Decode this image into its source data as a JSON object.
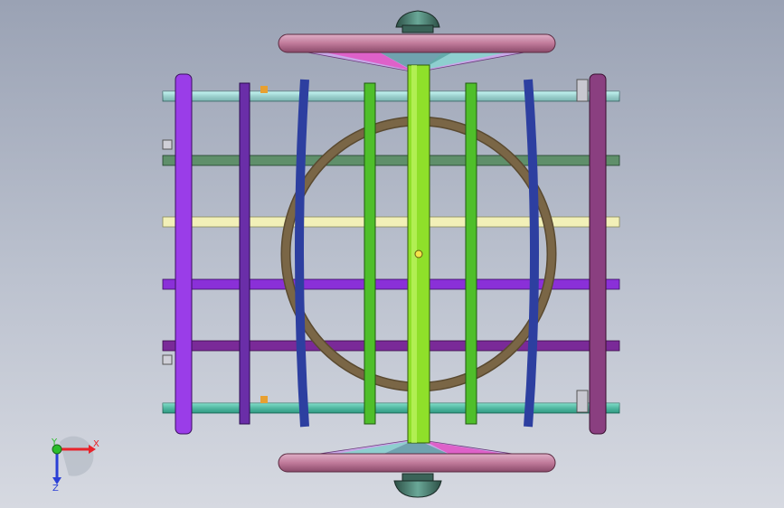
{
  "viewport": {
    "background_top": "#9aa2b4",
    "background_bottom": "#d6d9e1"
  },
  "triad": {
    "x_label": "X",
    "y_label": "Y",
    "z_label": "Z",
    "x_color": "#e8232a",
    "y_color": "#2bbd2b",
    "z_color": "#2a3fd6"
  },
  "model": {
    "parts": [
      "top-spoked-wheel",
      "bottom-spoked-wheel",
      "top-hub-pulley",
      "bottom-hub-pulley",
      "vertical-frame-bars",
      "horizontal-rails",
      "center-spine",
      "circular-ring",
      "curved-ribs"
    ],
    "colors": {
      "wheel_rim": "#c07a9a",
      "wheel_spokes": "#d0a0e0",
      "hub": "#3b6d60",
      "ring": "#7a6646",
      "spine": "#8fe02a",
      "bar_left_outer": "#9a3de8",
      "bar_left_inner": "#6a2ea8",
      "bar_green": "#4fbf2a",
      "bar_right_outer": "#8a3f80",
      "rib_blue": "#2d3fa0",
      "rail_cyan": "#a8f4f0",
      "rail_dark_green": "#5f8f6a",
      "rail_cream": "#f2f0b8",
      "rail_purple": "#8a30d8",
      "rail_violet": "#7a2a98",
      "rail_teal": "#3fd0b0"
    }
  }
}
